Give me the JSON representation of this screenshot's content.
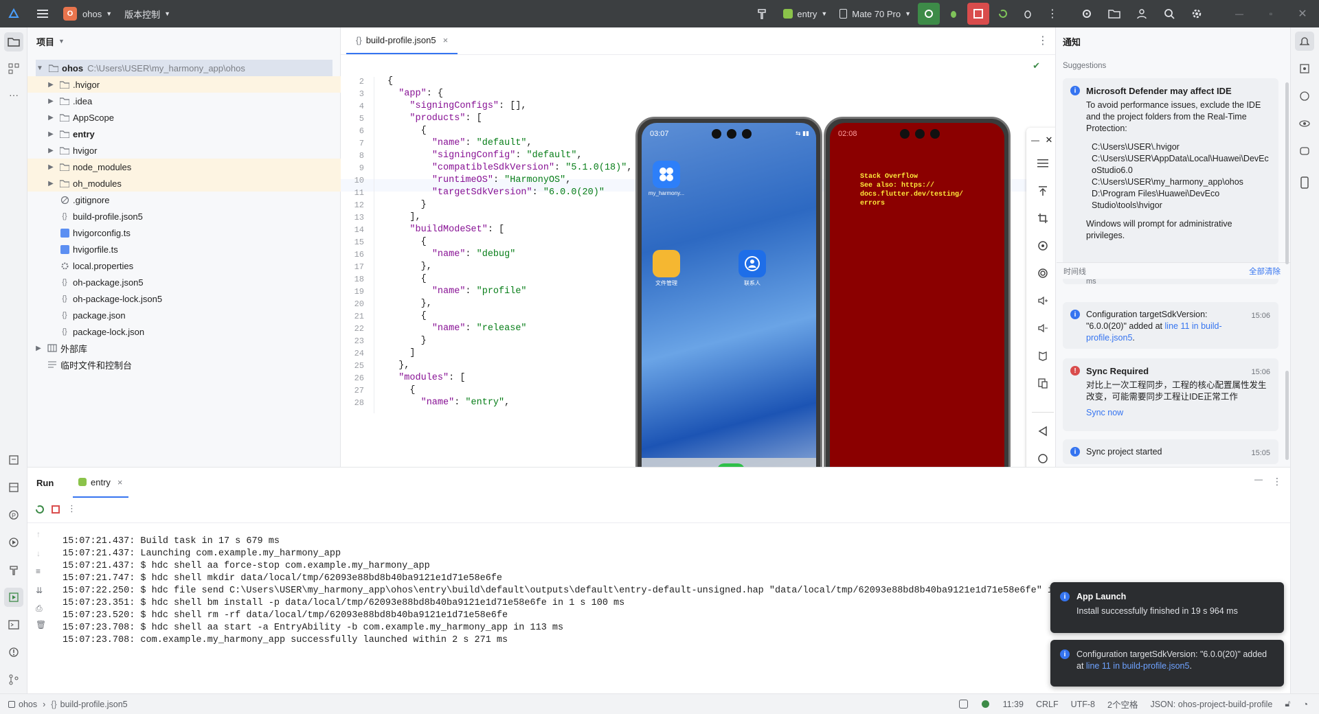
{
  "titlebar": {
    "project_initial": "O",
    "project_name": "ohos",
    "vcs": "版本控制",
    "module": "entry",
    "device": "Mate 70 Pro"
  },
  "project_panel": {
    "title": "项目",
    "root_name": "ohos",
    "root_path": "C:\\Users\\USER\\my_harmony_app\\ohos",
    "items": [
      {
        "label": "ohos"
      },
      {
        "label": ".hvigor"
      },
      {
        "label": ".idea"
      },
      {
        "label": "AppScope"
      },
      {
        "label": "entry"
      },
      {
        "label": "hvigor"
      },
      {
        "label": "node_modules"
      },
      {
        "label": "oh_modules"
      },
      {
        "label": ".gitignore"
      },
      {
        "label": "build-profile.json5"
      },
      {
        "label": "hvigorconfig.ts"
      },
      {
        "label": "hvigorfile.ts"
      },
      {
        "label": "local.properties"
      },
      {
        "label": "oh-package.json5"
      },
      {
        "label": "oh-package-lock.json5"
      },
      {
        "label": "package.json"
      },
      {
        "label": "package-lock.json"
      },
      {
        "label": "外部库"
      },
      {
        "label": "临时文件和控制台"
      }
    ]
  },
  "editor": {
    "tab": "build-profile.json5",
    "line_numbers": [
      "2",
      "3",
      "4",
      "5",
      "6",
      "7",
      "8",
      "9",
      "10",
      "11",
      "12",
      "13",
      "14",
      "15",
      "16",
      "17",
      "18",
      "19",
      "20",
      "21",
      "22",
      "23",
      "24",
      "25",
      "26",
      "27",
      "28"
    ],
    "lines": [
      "{",
      "  \"app\": {",
      "    \"signingConfigs\": [],",
      "    \"products\": [",
      "      {",
      "        \"name\": \"default\",",
      "        \"signingConfig\": \"default\",",
      "        \"compatibleSdkVersion\": \"5.1.0(18)\",",
      "        \"runtimeOS\": \"HarmonyOS\",",
      "        \"targetSdkVersion\": \"6.0.0(20)\"",
      "      }",
      "    ],",
      "    \"buildModeSet\": [",
      "      {",
      "        \"name\": \"debug\"",
      "      },",
      "      {",
      "        \"name\": \"profile\"",
      "      },",
      "      {",
      "        \"name\": \"release\"",
      "      }",
      "    ]",
      "  },",
      "  \"modules\": [",
      "    {",
      "      \"name\": \"entry\","
    ]
  },
  "phone_left": {
    "time": "03:07",
    "app1_label": "my_harmony...",
    "app2_label": "文件管理",
    "app3_label": "联系人"
  },
  "phone_right": {
    "time": "02:08",
    "error_text": "Stack Overflow\nSee also: https://\ndocs.flutter.dev/testing/\nerrors"
  },
  "notifications": {
    "title": "通知",
    "suggestions": "Suggestions",
    "defender": {
      "title": "Microsoft Defender may affect IDE",
      "body1": "To avoid performance issues, exclude the IDE and the project folders from the Real-Time Protection:",
      "paths": [
        "C:\\Users\\USER\\.hvigor",
        "C:\\Users\\USER\\AppData\\Local\\Huawei\\DevEcoStudio6.0",
        "C:\\Users\\USER\\my_harmony_app\\ohos",
        "D:\\Program Files\\Huawei\\DevEco Studio\\tools\\hvigor"
      ],
      "body2": "Windows will prompt for administrative privileges."
    },
    "timeline": "时间线",
    "clear_all": "全部清除",
    "partial": "ms",
    "config": {
      "text": "Configuration targetSdkVersion: \"6.0.0(20)\" added at ",
      "link": "line 11 in build-profile.json5",
      "end": ".",
      "time": "15:06"
    },
    "sync": {
      "title": "Sync Required",
      "body": "对比上一次工程同步，工程的核心配置属性发生改变，可能需要同步工程让IDE正常工作",
      "link": "Sync now",
      "time": "15:06"
    },
    "sync_started": {
      "text": "Sync project started",
      "time": "15:05"
    }
  },
  "run": {
    "label": "Run",
    "tab": "entry",
    "lines": [
      "15:07:21.437: Build task in 17 s 679 ms",
      "15:07:21.437: Launching com.example.my_harmony_app",
      "15:07:21.437: $ hdc shell aa force-stop com.example.my_harmony_app",
      "15:07:21.747: $ hdc shell mkdir data/local/tmp/62093e88bd8b40ba9121e1d71e58e6fe",
      "15:07:22.250: $ hdc file send C:\\Users\\USER\\my_harmony_app\\ohos\\entry\\build\\default\\outputs\\default\\entry-default-unsigned.hap \"data/local/tmp/62093e88bd8b40ba9121e1d71e58e6fe\" in",
      "15:07:23.351: $ hdc shell bm install -p data/local/tmp/62093e88bd8b40ba9121e1d71e58e6fe in 1 s 100 ms",
      "15:07:23.520: $ hdc shell rm -rf data/local/tmp/62093e88bd8b40ba9121e1d71e58e6fe",
      "15:07:23.708: $ hdc shell aa start -a EntryAbility -b com.example.my_harmony_app in 113 ms",
      "15:07:23.708: com.example.my_harmony_app successfully launched within 2 s 271 ms"
    ]
  },
  "toasts": {
    "launch": {
      "title": "App Launch",
      "body": "Install successfully finished in 19 s 964 ms"
    },
    "config": {
      "text": "Configuration targetSdkVersion: \"6.0.0(20)\" added at ",
      "link": "line 11 in build-profile.json5",
      "end": "."
    }
  },
  "status": {
    "crumb1": "ohos",
    "crumb2": "build-profile.json5",
    "position": "11:39",
    "line_sep": "CRLF",
    "encoding": "UTF-8",
    "indent": "2个空格",
    "schema": "JSON: ohos-project-build-profile"
  },
  "colors": {
    "accent": "#3574f0",
    "titlebar": "#3c3f41",
    "error_red": "#8b0000",
    "run_green": "#3d8b48",
    "stop_red": "#d94c4c"
  }
}
